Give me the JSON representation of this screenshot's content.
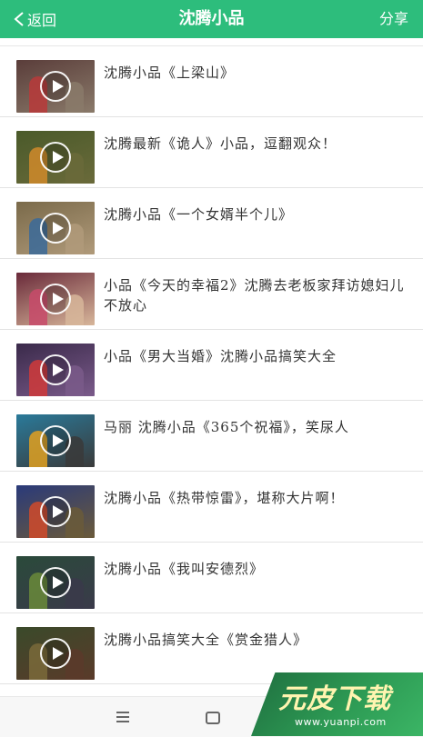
{
  "header": {
    "back_label": "返回",
    "title": "沈腾小品",
    "share_label": "分享",
    "accent_color": "#2dbd7c"
  },
  "videos": [
    {
      "title": "沈腾小品《上梁山》",
      "thumb_colors": [
        "#5a3d3a",
        "#b93a3a",
        "#8a7a6a"
      ]
    },
    {
      "title": "沈腾最新《诡人》小品，逗翻观众！",
      "thumb_colors": [
        "#4a5a2a",
        "#d08a2a",
        "#6a6a3a"
      ]
    },
    {
      "title": "沈腾小品《一个女婿半个儿》",
      "thumb_colors": [
        "#7a6a4a",
        "#3a6a9a",
        "#b09a7a"
      ]
    },
    {
      "title": "小品《今天的幸福2》沈腾去老板家拜访媳妇儿不放心",
      "thumb_colors": [
        "#6a2a3a",
        "#c84a6a",
        "#d7b69a"
      ]
    },
    {
      "title": "小品《男大当婚》沈腾小品搞笑大全",
      "thumb_colors": [
        "#3a2a4a",
        "#d03a3a",
        "#7a5a8a"
      ]
    },
    {
      "title": "马丽 沈腾小品《365个祝福》，笑尿人",
      "thumb_colors": [
        "#2a7a9a",
        "#e0a020",
        "#3a3a3a"
      ]
    },
    {
      "title": "沈腾小品《热带惊雷》，堪称大片啊！",
      "thumb_colors": [
        "#2a3a7a",
        "#d04a2a",
        "#6a5a3a"
      ]
    },
    {
      "title": "沈腾小品《我叫安德烈》",
      "thumb_colors": [
        "#2a4a3a",
        "#6a8a3a",
        "#3a3a4a"
      ]
    },
    {
      "title": "沈腾小品搞笑大全《赏金猎人》",
      "thumb_colors": [
        "#3a4a2a",
        "#7a6a3a",
        "#5a3a2a"
      ]
    }
  ],
  "nav": {
    "icons": [
      "menu-icon",
      "home-icon"
    ]
  },
  "watermark": {
    "brand": "元皮下载",
    "url": "www.yuanpi.com"
  }
}
